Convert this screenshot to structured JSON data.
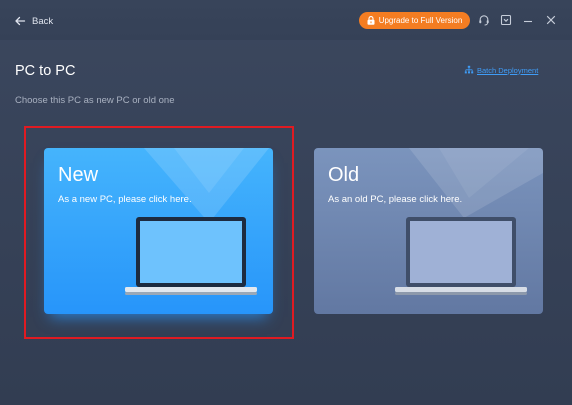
{
  "header": {
    "back_label": "Back",
    "upgrade_label": "Upgrade to Full Version",
    "icons": [
      "arrow-left-icon",
      "lock-icon",
      "support-icon",
      "menu-icon",
      "minimize-icon",
      "close-icon"
    ]
  },
  "page": {
    "title": "PC to PC",
    "subtitle": "Choose this PC as new PC or old one",
    "batch_link": "Batch Deployment"
  },
  "cards": [
    {
      "title": "New",
      "description": "As a new PC, please click here.",
      "selected": true
    },
    {
      "title": "Old",
      "description": "As an old PC, please click here.",
      "selected": false
    }
  ],
  "colors": {
    "background": "#3b475e",
    "accent_orange": "#f47d22",
    "link_blue": "#3f9cf6",
    "new_card": "#2e9cfb",
    "old_card": "#7087b1",
    "highlight_red": "#e01b22"
  }
}
